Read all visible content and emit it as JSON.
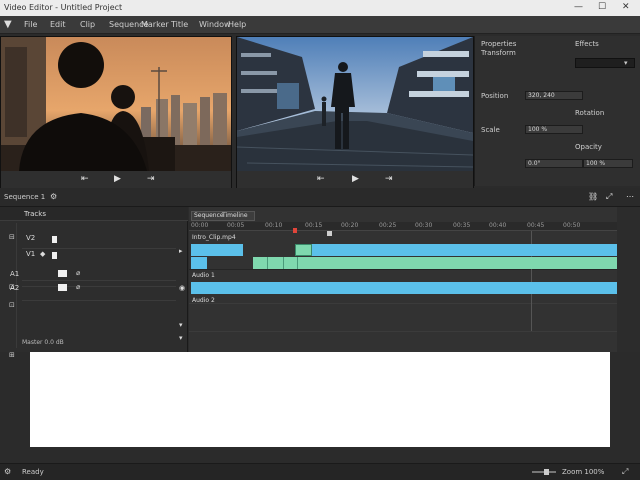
{
  "window": {
    "title": "Video Editor - Untitled Project",
    "controls": [
      "—",
      "☐",
      "✕"
    ]
  },
  "menu": {
    "items": [
      {
        "label": "File"
      },
      {
        "label": "Edit"
      },
      {
        "label": "Clip"
      },
      {
        "label": "Sequence"
      },
      {
        "label": "Marker"
      },
      {
        "label": "Title"
      },
      {
        "label": "Window"
      },
      {
        "label": "Help"
      }
    ]
  },
  "source_controls": {
    "prev": "⇤",
    "play": "▶",
    "next": "⇥"
  },
  "program_controls": {
    "prev": "⇤",
    "play": "▶",
    "next": "⇥"
  },
  "inspector": {
    "tab1": "Properties",
    "tab2": "Effects",
    "subtitle": "Transform",
    "rows": [
      {
        "label": "Position",
        "value": "320, 240"
      },
      {
        "label": "Scale",
        "value": "100 %"
      },
      {
        "label": "Rotation",
        "value": "0.0°"
      },
      {
        "label": "Opacity",
        "value": "100 %"
      }
    ]
  },
  "section": {
    "title": "Sequence 1",
    "icons": [
      "⚙",
      "⤢",
      "⋯"
    ]
  },
  "track_panel": {
    "header": "Tracks",
    "rows": [
      {
        "id": "V2"
      },
      {
        "id": "V1"
      },
      {
        "id": "A1"
      },
      {
        "id": "A2"
      }
    ],
    "footer": "Master 0.0 dB"
  },
  "timeline": {
    "tabs": [
      "Sequence",
      "Timeline"
    ],
    "clip_label": "Intro_Clip.mp4",
    "audio_label": "Audio 1",
    "audio_label2": "Audio 2",
    "ticks": [
      "00:00",
      "00:05",
      "00:10",
      "00:15",
      "00:20",
      "00:25",
      "00:30",
      "00:35",
      "00:40",
      "00:45",
      "00:50"
    ]
  },
  "status": {
    "left": "Ready",
    "right": "Zoom 100%"
  }
}
